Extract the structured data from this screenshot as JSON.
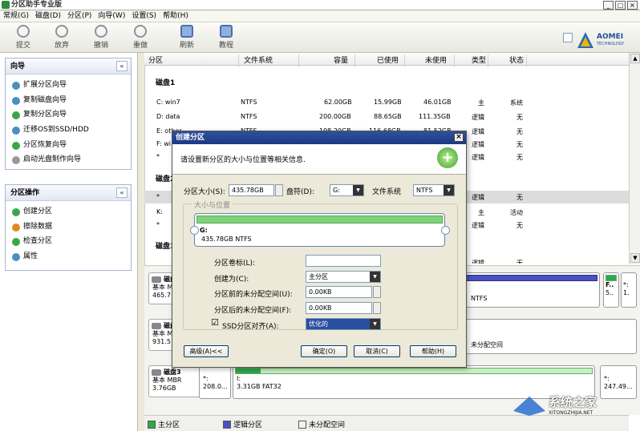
{
  "app": {
    "title": "分区助手专业版"
  },
  "window": {
    "minimize": "_",
    "restore": "□",
    "close": "×"
  },
  "menu": [
    "常规(G)",
    "磁盘(D)",
    "分区(P)",
    "向导(W)",
    "设置(S)",
    "帮助(H)"
  ],
  "toolbar": {
    "commit": "提交",
    "discard": "放弃",
    "undo": "撤销",
    "redo": "重做",
    "refresh": "刷新",
    "tutorial": "教程"
  },
  "brand": {
    "name": "AOMEI",
    "sub": "TECHNOLOGY"
  },
  "wizard_panel": {
    "title": "向导",
    "collapse": "«",
    "items": [
      "扩展分区向导",
      "复制磁盘向导",
      "复制分区向导",
      "迁移OS到SSD/HDD",
      "分区恢复向导",
      "启动光盘制作向导"
    ]
  },
  "ops_panel": {
    "title": "分区操作",
    "collapse": "«",
    "items": [
      "创建分区",
      "擦除数据",
      "检查分区",
      "属性"
    ]
  },
  "columns": [
    "分区",
    "文件系统",
    "容量",
    "已使用",
    "未使用",
    "类型",
    "状态"
  ],
  "disk1_label": "磁盘1",
  "disk2_label": "磁盘2",
  "disk3_label": "磁盘3",
  "rows": [
    {
      "name": "C: win7",
      "fs": "NTFS",
      "cap": "62.00GB",
      "used": "15.99GB",
      "free": "46.01GB",
      "type": "主",
      "status": "系统"
    },
    {
      "name": "D: data",
      "fs": "NTFS",
      "cap": "200.00GB",
      "used": "88.65GB",
      "free": "111.35GB",
      "type": "逻辑",
      "status": "无"
    },
    {
      "name": "E: other",
      "fs": "NTFS",
      "cap": "198.20GB",
      "used": "116.68GB",
      "free": "81.52GB",
      "type": "逻辑",
      "status": "无"
    },
    {
      "name": "F: wi",
      "fs": "",
      "cap": "",
      "used": "",
      "free": "",
      "type": "逻辑",
      "status": "无"
    },
    {
      "name": "*",
      "fs": "",
      "cap": "",
      "used": "",
      "free": "",
      "type": "逻辑",
      "status": "无"
    }
  ],
  "rows2": [
    {
      "name": "*",
      "type": "逻辑",
      "status": "无"
    },
    {
      "name": "K:",
      "type": "主",
      "status": "活动"
    },
    {
      "name": "*",
      "type": "逻辑",
      "status": "无"
    }
  ],
  "row_partial": {
    "type": "逻辑",
    "status": "无"
  },
  "disk_cards": [
    {
      "name": "磁盘1",
      "type": "基本 M",
      "size": "465.7"
    },
    {
      "name": "磁盘2",
      "type": "基本 M",
      "size": "931.5"
    },
    {
      "name": "磁盘3",
      "type": "基本 MBR",
      "size": "3.76GB"
    }
  ],
  "map_d1": {
    "fs": "NTFS",
    "f_label": "F..",
    "f_sub": "5..",
    "star": "*:",
    "star_sub": "1."
  },
  "map_d2": {
    "text": "未分配空间"
  },
  "map_d3": {
    "p1_name": "*:",
    "p1_size": "208.0...",
    "p2_name": "I:",
    "p2_size": "3.31GB FAT32",
    "p3_name": "*:",
    "p3_size": "247.49..."
  },
  "legend": {
    "primary": "主分区",
    "logical": "逻辑分区",
    "unalloc": "未分配空间"
  },
  "colors": {
    "primary": "#2fa84a",
    "logical": "#4b4fc8",
    "unalloc": "#f5f5f0",
    "accent": "#1f3e8a"
  },
  "dialog": {
    "title": "创建分区",
    "close": "×",
    "desc": "请设置新分区的大小与位置等相关信息.",
    "size_label": "分区大小(S):",
    "size_value": "435.78GB",
    "drive_label": "盘符(D):",
    "drive_value": "G:",
    "fs_label": "文件系统",
    "fs_value": "NTFS",
    "group_title": "大小与位置",
    "part_name": "G:",
    "part_info": "435.78GB NTFS",
    "vol_label": "分区卷标(L):",
    "vol_value": "",
    "create_as_label": "创建为(C):",
    "create_as_value": "主分区",
    "before_label": "分区前的未分配空间(U):",
    "before_value": "0.00KB",
    "after_label": "分区后的未分配空间(F):",
    "after_value": "0.00KB",
    "ssd_label": "SSD分区对齐(A):",
    "ssd_checked": "☑",
    "ssd_value": "优化的",
    "advanced": "高级(A)<<",
    "ok": "确定(O)",
    "cancel": "取消(C)",
    "help": "帮助(H)"
  },
  "watermark": {
    "text": "系统之家",
    "url": "XITONGZHIJIA.NET"
  }
}
